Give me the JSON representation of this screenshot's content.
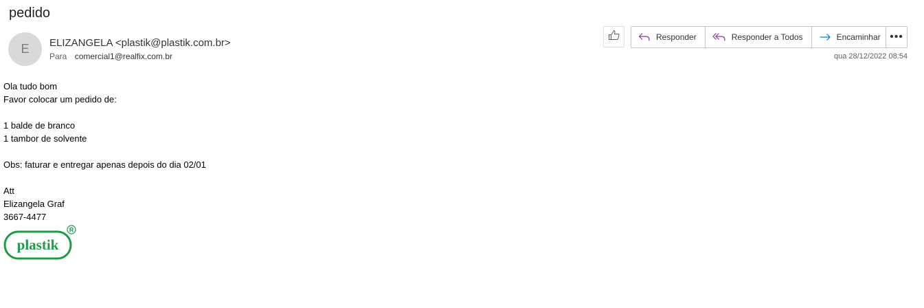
{
  "email": {
    "subject": "pedido",
    "avatar_initial": "E",
    "sender": "ELIZANGELA <plastik@plastik.com.br>",
    "to_label": "Para",
    "to_address": "comercial1@realfix.com.br",
    "timestamp": "qua 28/12/2022 08:54"
  },
  "actions": {
    "like_icon": "thumbs-up-icon",
    "reply_label": "Responder",
    "reply_all_label": "Responder a Todos",
    "forward_label": "Encaminhar",
    "more_label": "•••"
  },
  "body_lines": [
    "Ola tudo bom",
    "Favor colocar um pedido de:",
    "",
    "1 balde de branco",
    "1 tambor de solvente",
    "",
    "Obs: faturar e entregar apenas depois do dia 02/01",
    "",
    "Att",
    "Elizangela Graf",
    "3667-4477"
  ],
  "logo": {
    "text": "plastik",
    "mark": "®",
    "color": "#1f9a48"
  },
  "colors": {
    "reply_icon": "#8b3a9e",
    "forward_icon": "#0078d4"
  }
}
